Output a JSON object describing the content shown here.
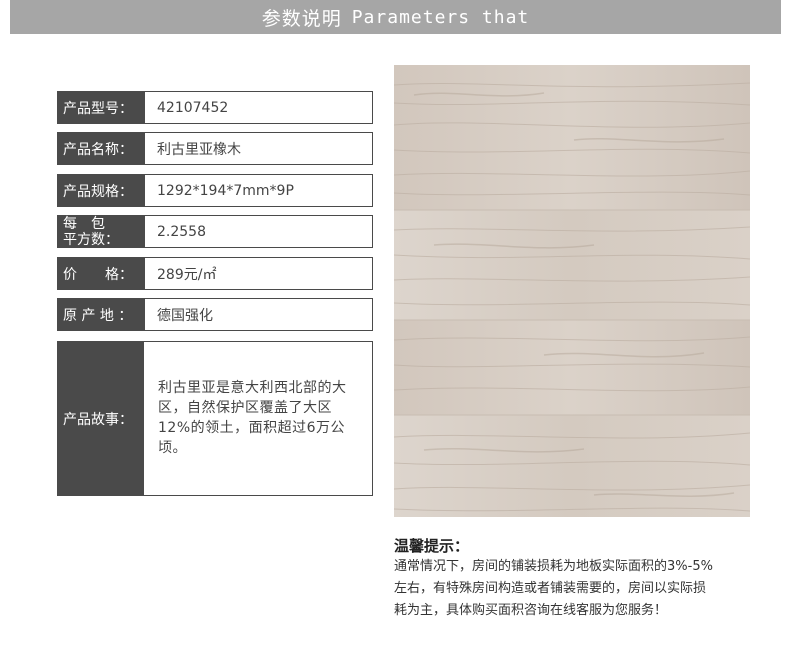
{
  "header": {
    "title_cn": "参数说明",
    "title_en": "Parameters that"
  },
  "specs": [
    {
      "label": "产品型号：",
      "value": "42107452"
    },
    {
      "label": "产品名称：",
      "value": "利古里亚橡木"
    },
    {
      "label": "产品规格：",
      "value": "1292*194*7mm*9P"
    },
    {
      "label_line1": "每　包",
      "label_line2": "平方数：",
      "value": "2.2558"
    },
    {
      "label": "价　　格：",
      "value": "289元/㎡"
    },
    {
      "label": "原 产 地 ：",
      "value": "德国强化"
    }
  ],
  "story": {
    "label": "产品故事：",
    "text": "利古里亚是意大利西北部的大区，自然保护区覆盖了大区12%的领土，面积超过6万公顷。"
  },
  "tips": {
    "title": "温馨提示：",
    "body": "通常情况下，房间的铺装损耗为地板实际面积的3%-5%左右，有特殊房间构造或者铺装需要的，房间以实际损耗为主，具体购买面积咨询在线客服为您服务！"
  },
  "colors": {
    "header_bg": "#a6a6a6",
    "label_bg": "#4a4a4a",
    "wood_base": "#d6ccc3"
  }
}
